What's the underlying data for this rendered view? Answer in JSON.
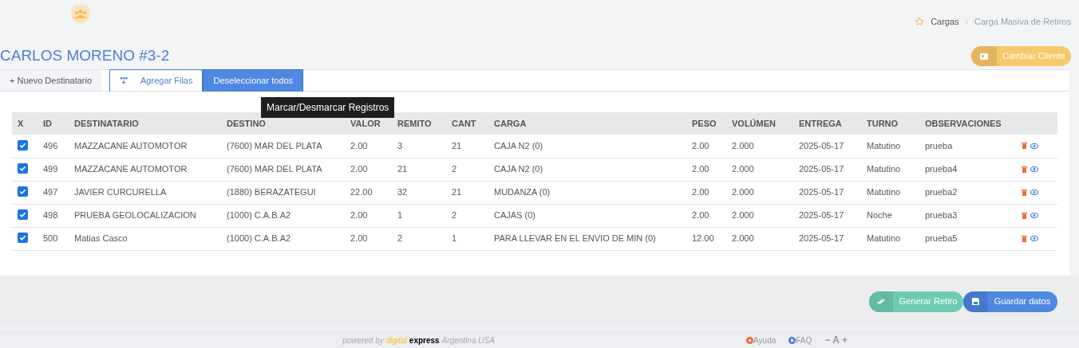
{
  "breadcrumb": [
    {
      "label": "Cargas",
      "selected": false
    },
    {
      "label": "Carga Masiva de Retiros",
      "selected": true
    }
  ],
  "breadcrumb_separator": "›",
  "title": "CARLOS MORENO #3-2",
  "change_client_button": "Cambiar Cliente",
  "tabs": [
    {
      "label": "+ Nuevo Destinatario",
      "kind": "tab"
    },
    {
      "label": "Agregar Filas",
      "kind": "outline"
    },
    {
      "label": "Deseleccionar todos",
      "kind": "primary"
    }
  ],
  "tooltip": "Marcar/Desmarcar Registros",
  "table": {
    "columns": [
      "X",
      "ID",
      "DESTINATARIO",
      "DESTINO",
      "VALOR",
      "REMITO",
      "CANT",
      "CARGA",
      "PESO",
      "VOLÚMEN",
      "ENTREGA",
      "TURNO",
      "OBSERVACIONES"
    ],
    "rows": [
      {
        "checked": true,
        "cells": [
          "",
          "496",
          "MAZZACANE AUTOMOTOR",
          "(7600) MAR DEL PLATA",
          "2.00",
          "3",
          "21",
          "CAJA N2 (0)",
          "2.00",
          "2.000",
          "2025-05-17",
          "Matutino",
          "prueba"
        ]
      },
      {
        "checked": true,
        "cells": [
          "",
          "499",
          "MAZZACANE AUTOMOTOR",
          "(7600) MAR DEL PLATA",
          "2.00",
          "21",
          "2",
          "CAJA N2 (0)",
          "2.00",
          "2.000",
          "2025-05-17",
          "Matutino",
          "prueba4"
        ]
      },
      {
        "checked": true,
        "cells": [
          "",
          "497",
          "JAVIER CURCURELLA",
          "(1880) BERAZATEGUI",
          "22.00",
          "32",
          "21",
          "MUDANZA (0)",
          "2.00",
          "2.000",
          "2025-05-17",
          "Matutino",
          "prueba2"
        ]
      },
      {
        "checked": true,
        "cells": [
          "",
          "498",
          "PRUEBA GEOLOCALIZACION",
          "(1000) C.A.B.A2",
          "2.00",
          "1",
          "2",
          "CAJAS (0)",
          "2.00",
          "2.000",
          "2025-05-17",
          "Noche",
          "prueba3"
        ]
      },
      {
        "checked": true,
        "cells": [
          "",
          "500",
          "Matias Casco",
          "(1000) C.A.B.A2",
          "2.00",
          "2",
          "1",
          "PARA LLEVAR EN EL ENVIO DE MIN (0)",
          "12.00",
          "2.000",
          "2025-05-17",
          "Matutino",
          "prueba5"
        ]
      }
    ]
  },
  "actions": [
    {
      "label": "Generar Retiro",
      "kind": "generate"
    },
    {
      "label": "Guardar datos",
      "kind": "save"
    }
  ],
  "footer": {
    "powered": "powered by",
    "brand_1": "digital",
    "brand_2": "express",
    "regions": "Argentina USA",
    "links": [
      "Ayuda",
      "FAQ"
    ],
    "font_controls": [
      "−",
      "A",
      "+"
    ]
  }
}
